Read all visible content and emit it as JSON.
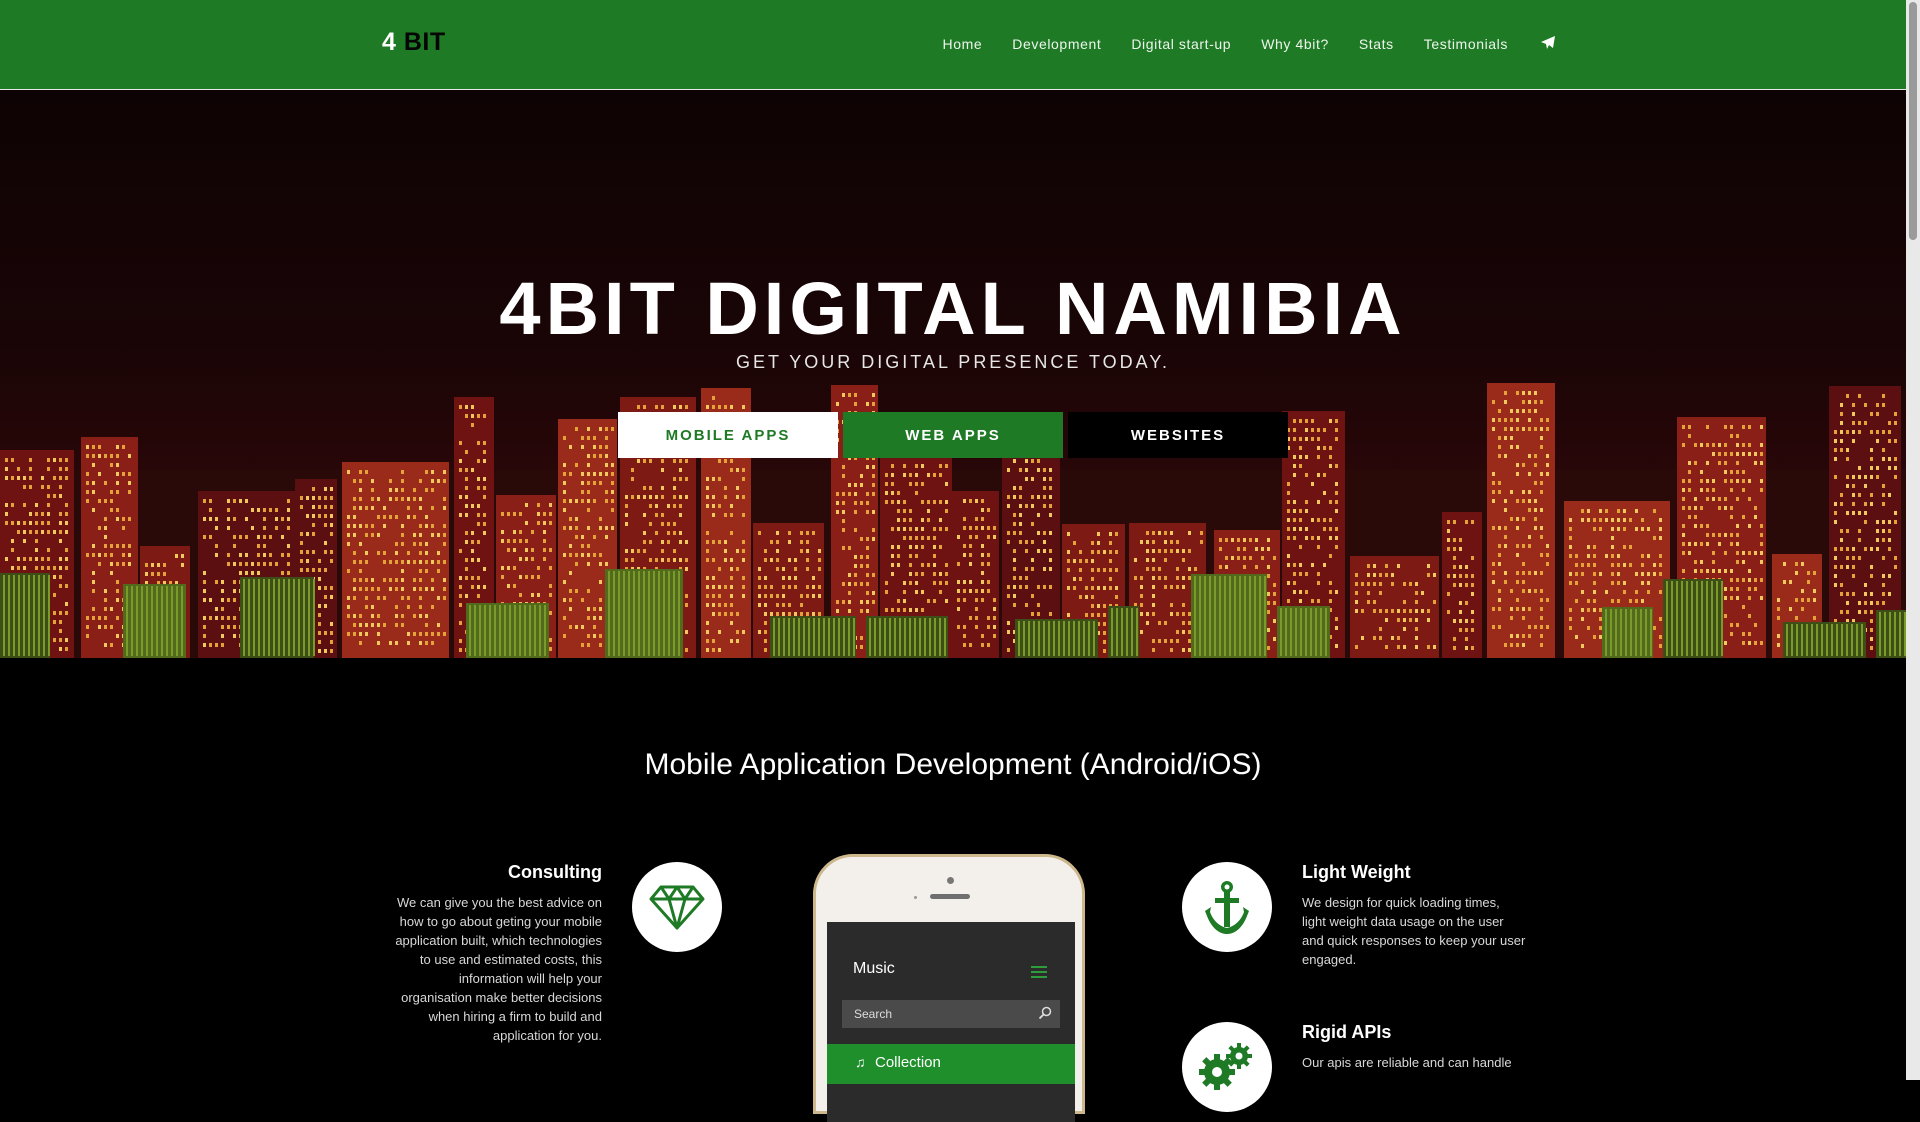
{
  "brand": {
    "prefix": "4",
    "suffix": "BIT"
  },
  "nav": {
    "items": [
      "Home",
      "Development",
      "Digital start-up",
      "Why 4bit?",
      "Stats",
      "Testimonials"
    ],
    "contact_icon": "paper-plane-icon"
  },
  "hero": {
    "title": "4BIT DIGITAL NAMIBIA",
    "subtitle": "GET YOUR DIGITAL PRESENCE TODAY.",
    "buttons": [
      "MOBILE APPS",
      "WEB APPS",
      "WEBSITES"
    ]
  },
  "section": {
    "title": "Mobile Application Development (Android/iOS)",
    "features": [
      {
        "title": "Consulting",
        "text": "We can give you the best advice on how to go about geting your mobile application built, which technologies to use and estimated costs, this information will help your organisation make better decisions when hiring a firm to build and application for you.",
        "icon": "diamond-icon"
      },
      {
        "title": "Light Weight",
        "text": "We design for quick loading times, light weight data usage on the user and quick responses to keep your user engaged.",
        "icon": "anchor-icon"
      },
      {
        "title": "Rigid APIs",
        "text": "Our apis are reliable and can handle",
        "icon": "gears-icon"
      }
    ]
  },
  "phone": {
    "app_title": "Music",
    "search_placeholder": "Search",
    "collection_label": "Collection"
  },
  "colors": {
    "brand_green": "#1e7a24",
    "background": "#000000"
  }
}
